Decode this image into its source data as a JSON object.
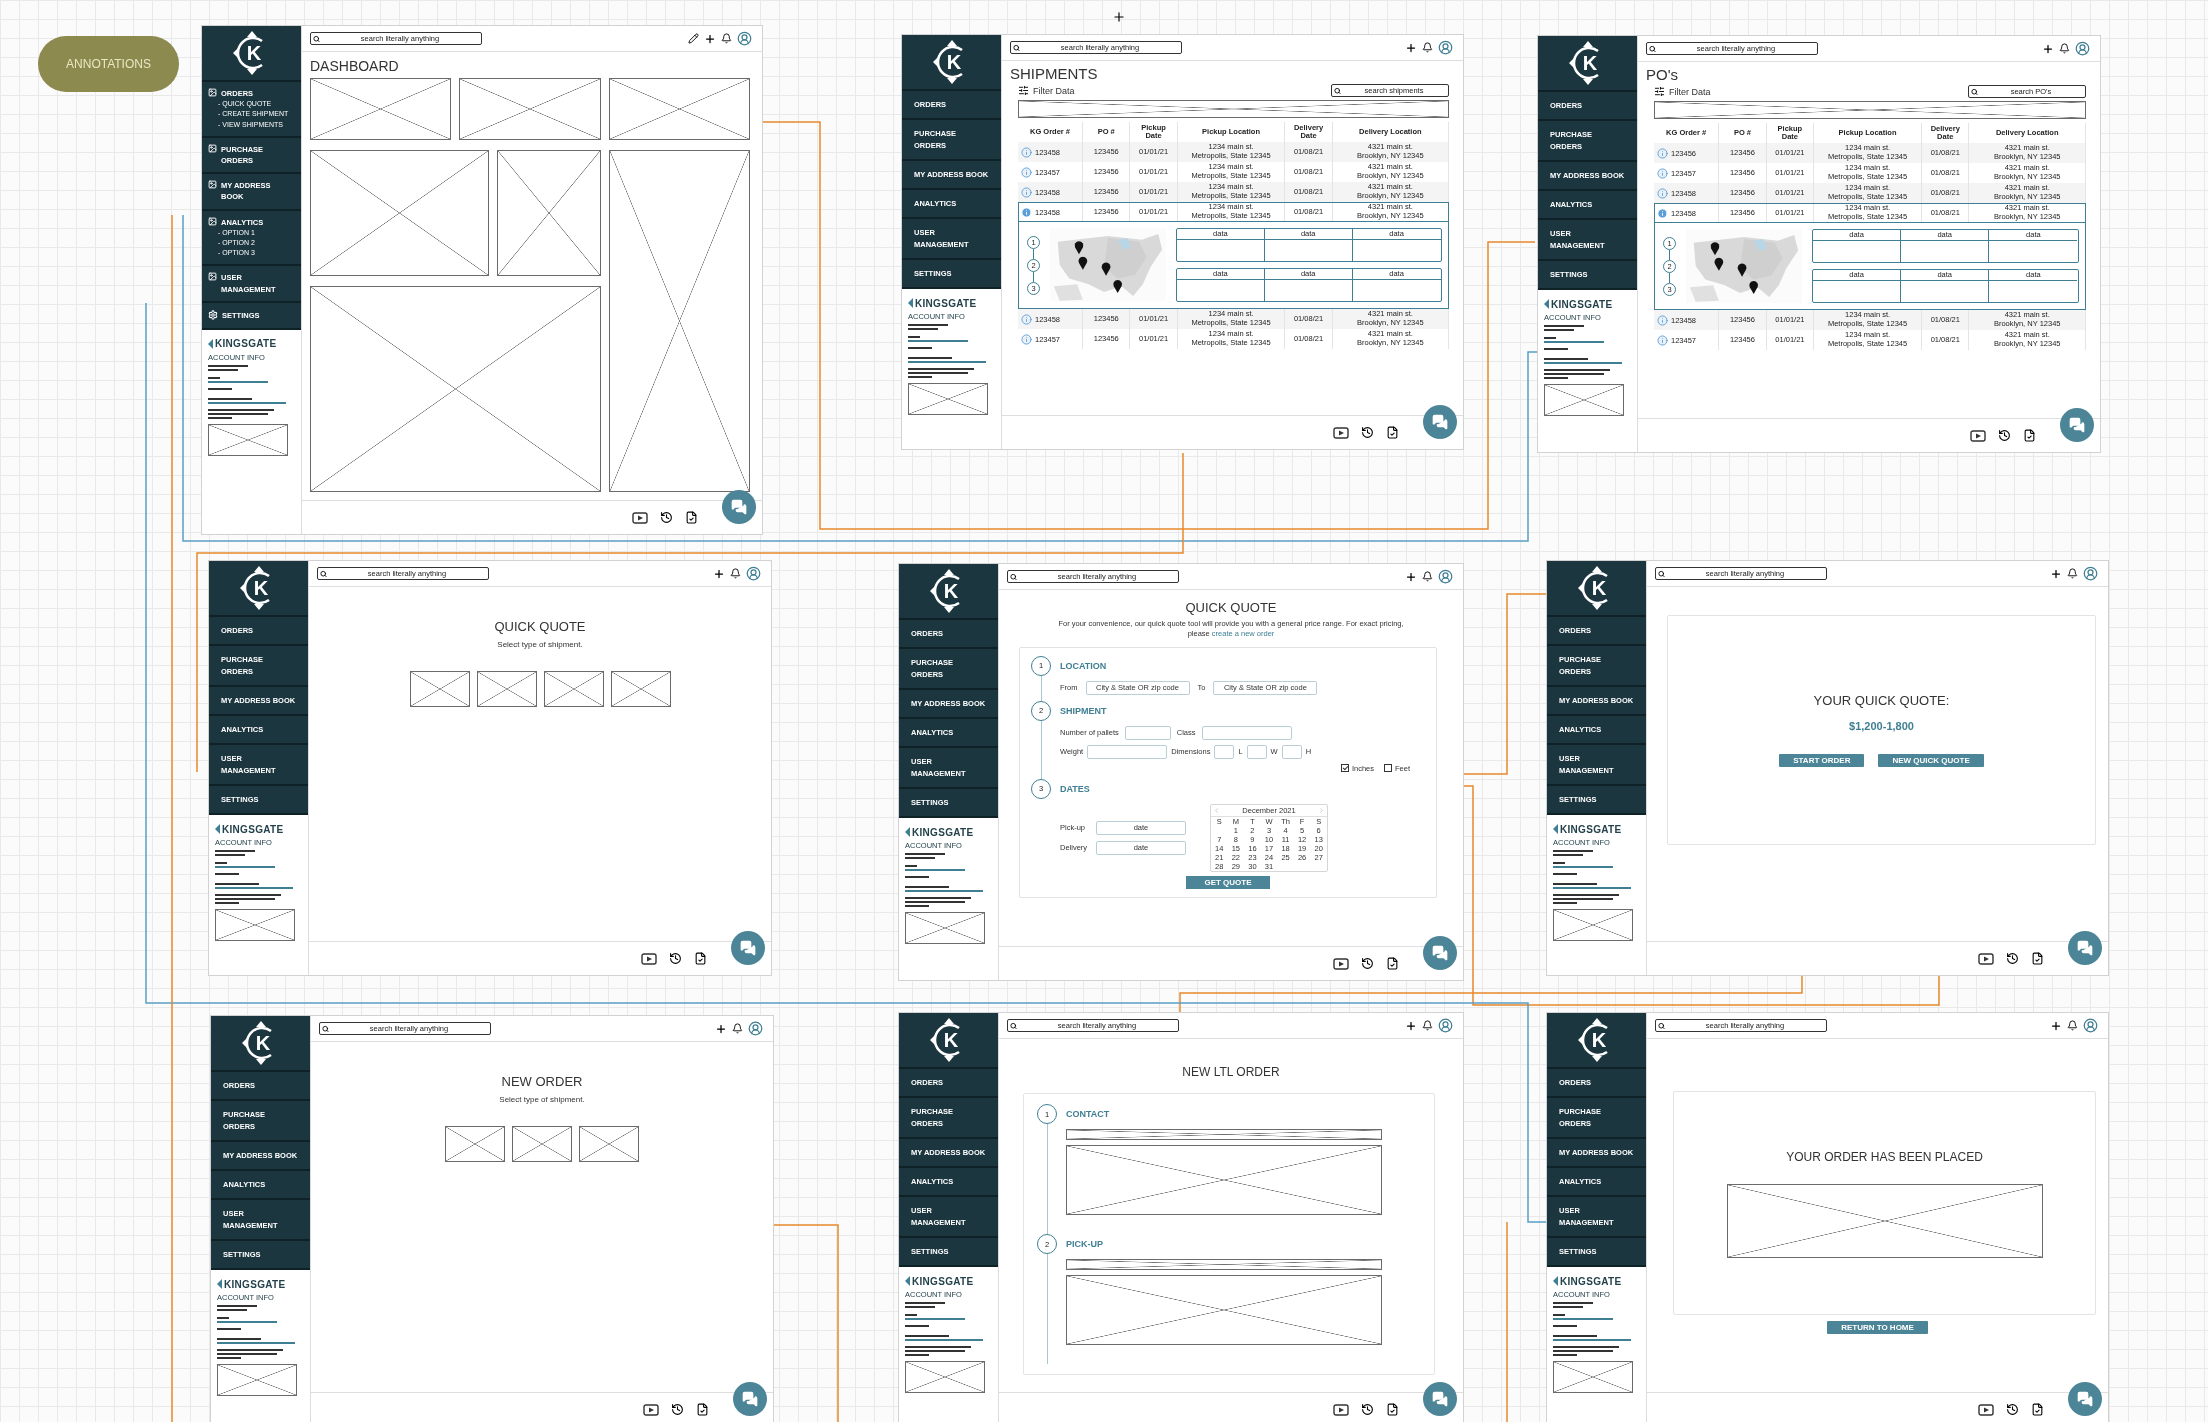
{
  "annotations": "ANNOTATIONS",
  "frames": [
    {
      "sidebar": {
        "kind": "with_icons",
        "logo": "K",
        "items": [
          {
            "label": "ORDERS",
            "children": [
              {
                "label": "- QUICK QUOTE"
              },
              {
                "label": "- CREATE SHIPMENT"
              },
              {
                "label": "- VIEW SHIPMENTS"
              }
            ]
          },
          {
            "label": "PURCHASE\nORDERS"
          },
          {
            "label": "MY ADDRESS BOOK"
          },
          {
            "label": "ANALYTICS",
            "children": [
              {
                "label": "- OPTION 1"
              },
              {
                "label": "- OPTION 2"
              },
              {
                "label": "- OPTION 3"
              }
            ]
          },
          {
            "label": "USER\nMANAGEMENT"
          },
          {
            "label": "SETTINGS"
          }
        ],
        "brand": "KINGSGATE",
        "account_title": "ACCOUNT INFO"
      },
      "topbar": {
        "search": {
          "placeholder": "search literally anything"
        },
        "edit": true
      },
      "content": {
        "kind": "dashboard",
        "title": "DASHBOARD",
        "widgets": [
          {
            "kind": "placeholder"
          },
          {
            "kind": "placeholder"
          },
          {
            "kind": "placeholder"
          },
          {
            "kind": "placeholder"
          },
          {
            "kind": "placeholder"
          },
          {
            "kind": "placeholder"
          },
          {
            "kind": "placeholder"
          }
        ]
      }
    },
    {
      "sidebar": {
        "kind": "plain",
        "logo": "K",
        "items": [
          {
            "label": "ORDERS"
          },
          {
            "label": "PURCHASE\nORDERS"
          },
          {
            "label": "MY ADDRESS BOOK"
          },
          {
            "label": "ANALYTICS"
          },
          {
            "label": "USER\nMANAGEMENT"
          },
          {
            "label": "SETTINGS"
          }
        ],
        "brand": "KINGSGATE",
        "account_title": "ACCOUNT INFO"
      },
      "topbar": {
        "search": {
          "placeholder": "search literally anything"
        },
        "edit": false
      },
      "content": {
        "kind": "table",
        "title": "SHIPMENTS",
        "filter": "Filter Data",
        "search": {
          "placeholder": "search shipments"
        },
        "table": {
          "columns": [
            "KG Order #",
            "PO #",
            "Pickup Date",
            "Pickup  Location",
            "Delivery Date",
            "Delivery Location"
          ],
          "rows": [
            {
              "order": "123458",
              "po": "123456",
              "pickup_date": "01/01/21",
              "pickup_street": "1234 main st.",
              "pickup_city": "Metropolis, State  12345",
              "delivery_date": "01/08/21",
              "delivery_street": "4321 main st.",
              "delivery_city": "Brooklyn, NY 12345",
              "selected": false
            },
            {
              "order": "123457",
              "po": "123456",
              "pickup_date": "01/01/21",
              "pickup_street": "1234 main st.",
              "pickup_city": "Metropolis, State  12345",
              "delivery_date": "01/08/21",
              "delivery_street": "4321 main st.",
              "delivery_city": "Brooklyn, NY 12345",
              "selected": false
            },
            {
              "order": "123458",
              "po": "123456",
              "pickup_date": "01/01/21",
              "pickup_street": "1234 main st.",
              "pickup_city": "Metropolis, State  12345",
              "delivery_date": "01/08/21",
              "delivery_street": "4321 main st.",
              "delivery_city": "Brooklyn, NY 12345",
              "selected": false
            },
            {
              "order": "123458",
              "po": "123456",
              "pickup_date": "01/01/21",
              "pickup_street": "1234 main st.",
              "pickup_city": "Metropolis, State  12345",
              "delivery_date": "01/08/21",
              "delivery_street": "4321 main st.",
              "delivery_city": "Brooklyn, NY 12345",
              "selected": true
            },
            {
              "order": "123458",
              "po": "123456",
              "pickup_date": "01/01/21",
              "pickup_street": "1234 main st.",
              "pickup_city": "Metropolis, State  12345",
              "delivery_date": "01/08/21",
              "delivery_street": "4321 main st.",
              "delivery_city": "Brooklyn, NY 12345",
              "selected": false
            },
            {
              "order": "123457",
              "po": "123456",
              "pickup_date": "01/01/21",
              "pickup_street": "1234 main st.",
              "pickup_city": "Metropolis, State  12345",
              "delivery_date": "01/08/21",
              "delivery_street": "4321 main st.",
              "delivery_city": "Brooklyn, NY 12345",
              "selected": false
            }
          ],
          "details": {
            "steps": [
              "1",
              "2",
              "3"
            ],
            "grids": [
              [
                "data",
                "data",
                "data"
              ],
              [
                "data",
                "data",
                "data"
              ]
            ]
          }
        }
      }
    },
    {
      "sidebar": {
        "kind": "plain",
        "logo": "K",
        "items": [
          {
            "label": "ORDERS"
          },
          {
            "label": "PURCHASE\nORDERS"
          },
          {
            "label": "MY ADDRESS BOOK"
          },
          {
            "label": "ANALYTICS"
          },
          {
            "label": "USER\nMANAGEMENT"
          },
          {
            "label": "SETTINGS"
          }
        ],
        "brand": "KINGSGATE",
        "account_title": "ACCOUNT INFO"
      },
      "topbar": {
        "search": {
          "placeholder": "search literally anything"
        },
        "edit": false
      },
      "content": {
        "kind": "table",
        "title": "PO's",
        "filter": "Filter Data",
        "search": {
          "placeholder": "search PO's"
        },
        "table": {
          "columns": [
            "KG Order #",
            "PO #",
            "Pickup Date",
            "Pickup  Location",
            "Delivery Date",
            "Delivery Location"
          ],
          "rows": [
            {
              "order": "123456",
              "po": "123456",
              "pickup_date": "01/01/21",
              "pickup_street": "1234 main st.",
              "pickup_city": "Metropolis, State  12345",
              "delivery_date": "01/08/21",
              "delivery_street": "4321 main st.",
              "delivery_city": "Brooklyn, NY 12345",
              "selected": false
            },
            {
              "order": "123457",
              "po": "123456",
              "pickup_date": "01/01/21",
              "pickup_street": "1234 main st.",
              "pickup_city": "Metropolis, State  12345",
              "delivery_date": "01/08/21",
              "delivery_street": "4321 main st.",
              "delivery_city": "Brooklyn, NY 12345",
              "selected": false
            },
            {
              "order": "123458",
              "po": "123456",
              "pickup_date": "01/01/21",
              "pickup_street": "1234 main st.",
              "pickup_city": "Metropolis, State  12345",
              "delivery_date": "01/08/21",
              "delivery_street": "4321 main st.",
              "delivery_city": "Brooklyn, NY 12345",
              "selected": false
            },
            {
              "order": "123458",
              "po": "123456",
              "pickup_date": "01/01/21",
              "pickup_street": "1234 main st.",
              "pickup_city": "Metropolis, State  12345",
              "delivery_date": "01/08/21",
              "delivery_street": "4321 main st.",
              "delivery_city": "Brooklyn, NY 12345",
              "selected": true
            },
            {
              "order": "123458",
              "po": "123456",
              "pickup_date": "01/01/21",
              "pickup_street": "1234 main st.",
              "pickup_city": "Metropolis, State  12345",
              "delivery_date": "01/08/21",
              "delivery_street": "4321 main st.",
              "delivery_city": "Brooklyn, NY 12345",
              "selected": false
            },
            {
              "order": "123457",
              "po": "123456",
              "pickup_date": "01/01/21",
              "pickup_street": "1234 main st.",
              "pickup_city": "Metropolis, State  12345",
              "delivery_date": "01/08/21",
              "delivery_street": "4321 main st.",
              "delivery_city": "Brooklyn, NY 12345",
              "selected": false
            }
          ],
          "details": {
            "steps": [
              "1",
              "2",
              "3"
            ],
            "grids": [
              [
                "data",
                "data",
                "data"
              ],
              [
                "data",
                "data",
                "data"
              ]
            ]
          }
        }
      }
    },
    {
      "sidebar": {
        "kind": "plain",
        "logo": "K",
        "items": [
          {
            "label": "ORDERS"
          },
          {
            "label": "PURCHASE\nORDERS"
          },
          {
            "label": "MY ADDRESS BOOK"
          },
          {
            "label": "ANALYTICS"
          },
          {
            "label": "USER\nMANAGEMENT"
          },
          {
            "label": "SETTINGS"
          }
        ],
        "brand": "KINGSGATE",
        "account_title": "ACCOUNT INFO"
      },
      "topbar": {
        "search": {
          "placeholder": "search literally anything"
        },
        "edit": false
      },
      "content": {
        "kind": "select_type",
        "title": "QUICK QUOTE",
        "subtitle": "Select type of shipment.",
        "tiles": [
          {
            "kind": "placeholder"
          },
          {
            "kind": "placeholder"
          },
          {
            "kind": "placeholder"
          },
          {
            "kind": "placeholder"
          }
        ]
      }
    },
    {
      "sidebar": {
        "kind": "plain",
        "logo": "K",
        "items": [
          {
            "label": "ORDERS"
          },
          {
            "label": "PURCHASE\nORDERS"
          },
          {
            "label": "MY ADDRESS BOOK"
          },
          {
            "label": "ANALYTICS"
          },
          {
            "label": "USER\nMANAGEMENT"
          },
          {
            "label": "SETTINGS"
          }
        ],
        "brand": "KINGSGATE",
        "account_title": "ACCOUNT INFO"
      },
      "topbar": {
        "search": {
          "placeholder": "search literally anything"
        },
        "edit": false
      },
      "content": {
        "kind": "quote_form",
        "title": "QUICK QUOTE",
        "intro": "For your convenience, our quick quote tool will provide you with a general price range. For exact pricing, please",
        "intro_link": "create a new order",
        "form": {
          "steps": [
            {
              "kind": "location",
              "number": "1",
              "title": "LOCATION",
              "fields": [
                {
                  "label": "From",
                  "placeholder": "City & State OR zip code"
                },
                {
                  "label": "To",
                  "placeholder": "City & State OR zip code"
                }
              ]
            },
            {
              "kind": "shipment",
              "number": "2",
              "title": "SHIPMENT",
              "pallets_label": "Number of pallets",
              "class_label": "Class",
              "weight_label": "Weight",
              "dimensions_label": "Dimensions",
              "dims": [
                "L",
                "W",
                "H"
              ],
              "units": [
                {
                  "label": "Inches",
                  "checked": true
                },
                {
                  "label": "Feet",
                  "checked": false
                }
              ]
            },
            {
              "kind": "dates",
              "number": "3",
              "title": "DATES",
              "fields": [
                {
                  "label": "Pick-up",
                  "placeholder": "date"
                },
                {
                  "label": "Delivery",
                  "placeholder": "date"
                }
              ],
              "calendar": {
                "month": "December 2021",
                "weekdays": [
                  "S",
                  "M",
                  "T",
                  "W",
                  "Th",
                  "F",
                  "S"
                ],
                "weeks": [
                  [
                    "1",
                    "2",
                    "3",
                    "4",
                    "5",
                    "6"
                  ],
                  [
                    "7",
                    "8",
                    "9",
                    "10",
                    "11",
                    "12",
                    "13"
                  ],
                  [
                    "14",
                    "15",
                    "16",
                    "17",
                    "18",
                    "19",
                    "20"
                  ],
                  [
                    "21",
                    "22",
                    "23",
                    "24",
                    "25",
                    "26",
                    "27"
                  ],
                  [
                    "28",
                    "29",
                    "30",
                    "31"
                  ]
                ]
              }
            }
          ],
          "button": "GET QUOTE"
        }
      }
    },
    {
      "sidebar": {
        "kind": "plain",
        "logo": "K",
        "items": [
          {
            "label": "ORDERS"
          },
          {
            "label": "PURCHASE\nORDERS"
          },
          {
            "label": "MY ADDRESS BOOK"
          },
          {
            "label": "ANALYTICS"
          },
          {
            "label": "USER\nMANAGEMENT"
          },
          {
            "label": "SETTINGS"
          }
        ],
        "brand": "KINGSGATE",
        "account_title": "ACCOUNT INFO"
      },
      "topbar": {
        "search": {
          "placeholder": "search literally anything"
        },
        "edit": false
      },
      "content": {
        "kind": "quote_result",
        "title": "YOUR QUICK QUOTE:",
        "price": "$1,200-1,800",
        "buttons": [
          "START ORDER",
          "NEW QUICK QUOTE"
        ]
      }
    },
    {
      "sidebar": {
        "kind": "plain",
        "logo": "K",
        "items": [
          {
            "label": "ORDERS"
          },
          {
            "label": "PURCHASE\nORDERS"
          },
          {
            "label": "MY ADDRESS BOOK"
          },
          {
            "label": "ANALYTICS"
          },
          {
            "label": "USER\nMANAGEMENT"
          },
          {
            "label": "SETTINGS"
          }
        ],
        "brand": "KINGSGATE",
        "account_title": "ACCOUNT INFO"
      },
      "topbar": {
        "search": {
          "placeholder": "search literally anything"
        },
        "edit": false
      },
      "content": {
        "kind": "select_type",
        "title": "NEW ORDER",
        "subtitle": "Select type of shipment.",
        "tiles": [
          {
            "kind": "placeholder"
          },
          {
            "kind": "placeholder"
          },
          {
            "kind": "placeholder"
          }
        ]
      }
    },
    {
      "sidebar": {
        "kind": "plain",
        "logo": "K",
        "items": [
          {
            "label": "ORDERS"
          },
          {
            "label": "PURCHASE\nORDERS"
          },
          {
            "label": "MY ADDRESS BOOK"
          },
          {
            "label": "ANALYTICS"
          },
          {
            "label": "USER\nMANAGEMENT"
          },
          {
            "label": "SETTINGS"
          }
        ],
        "brand": "KINGSGATE",
        "account_title": "ACCOUNT INFO"
      },
      "topbar": {
        "search": {
          "placeholder": "search literally anything"
        },
        "edit": false
      },
      "content": {
        "kind": "ltl_order",
        "title": "NEW LTL ORDER",
        "steps": [
          {
            "number": "1",
            "title": "CONTACT"
          },
          {
            "number": "2",
            "title": "PICK-UP"
          }
        ]
      }
    },
    {
      "sidebar": {
        "kind": "plain",
        "logo": "K",
        "items": [
          {
            "label": "ORDERS"
          },
          {
            "label": "PURCHASE\nORDERS"
          },
          {
            "label": "MY ADDRESS BOOK"
          },
          {
            "label": "ANALYTICS"
          },
          {
            "label": "USER\nMANAGEMENT"
          },
          {
            "label": "SETTINGS"
          }
        ],
        "brand": "KINGSGATE",
        "account_title": "ACCOUNT INFO"
      },
      "topbar": {
        "search": {
          "placeholder": "search literally anything"
        },
        "edit": false
      },
      "content": {
        "kind": "order_placed",
        "title": "YOUR ORDER HAS BEEN PLACED",
        "button": "RETURN TO HOME"
      }
    }
  ]
}
